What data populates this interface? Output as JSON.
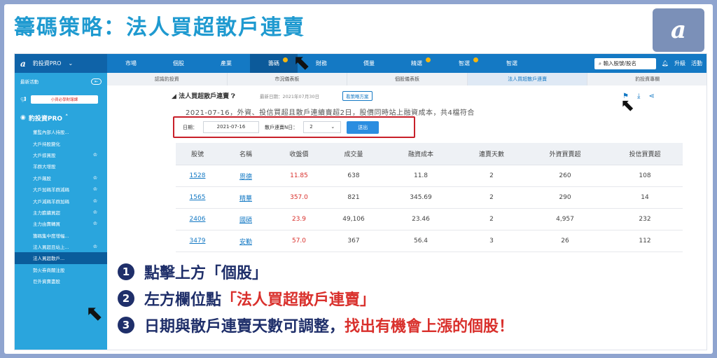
{
  "banner": {
    "title": "籌碼策略：法人買超散戶連賣",
    "logo": "a"
  },
  "nav": {
    "brand": "豹投資PRO",
    "items": [
      "市場",
      "個股",
      "產業",
      "籌碼",
      "財務",
      "價量",
      "精選",
      "智選",
      "智選"
    ],
    "search": "輸入股號/股名",
    "upgrade": "升級",
    "activity": "活動"
  },
  "sidebar": {
    "top_label": "最新活動",
    "promo": "小資必學財報課",
    "section": "豹投資PRO",
    "items": [
      "董監內部人持股...",
      "大戶持股變化",
      "大戶掠買股",
      "羊群大增股",
      "大戶飆股",
      "大戶加碼羊群減碼",
      "大戶減碼羊群加碼",
      "主力膽續買超",
      "主力由賣轉買",
      "籌碼集中度增幅...",
      "法人買超且站上...",
      "法人買超散戶...",
      "勢火券商關注股",
      "巨外資賣盡股"
    ]
  },
  "subtabs": [
    "認識豹投資",
    "市況儀表板",
    "個股儀表板",
    "法人買超散戶連賣",
    "豹投資專欄"
  ],
  "content": {
    "title": "法人買超散戶連賣",
    "updated": "最新日期：2021年07月30日",
    "strategy_btn": "看策略方案",
    "summary": "2021-07-16，外資、投信買超且散戶連續賣超2日，股價同時站上融資成本，共4檔符合",
    "filter": {
      "date_label": "日期：",
      "date": "2021-07-16",
      "days_label": "散戶連賣N日：",
      "days": "2",
      "query": "送出"
    }
  },
  "table": {
    "headers": [
      "股號",
      "名稱",
      "收盤價",
      "成交量",
      "融資成本",
      "連賣天數",
      "外資買賣超",
      "投信買賣超"
    ],
    "rows": [
      [
        "1528",
        "恩德",
        "11.85",
        "638",
        "11.8",
        "2",
        "260",
        "108"
      ],
      [
        "1565",
        "精華",
        "357.0",
        "821",
        "345.69",
        "2",
        "290",
        "14"
      ],
      [
        "2406",
        "國碩",
        "23.9",
        "49,106",
        "23.46",
        "2",
        "4,957",
        "232"
      ],
      [
        "3479",
        "安勤",
        "57.0",
        "367",
        "56.4",
        "3",
        "26",
        "112"
      ]
    ]
  },
  "steps": {
    "s1_num": "1",
    "s1": "點擊上方「個股」",
    "s2_num": "2",
    "s2a": "左方欄位點",
    "s2b": "「法人買超散戶連賣」",
    "s3_num": "3",
    "s3a": "日期與散戶連賣天數可調整，",
    "s3b": "找出有機會上漲的個股！"
  }
}
